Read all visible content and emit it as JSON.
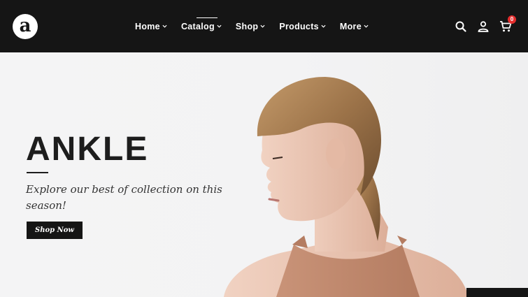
{
  "brand": {
    "logo_letter": "a",
    "logo_icon": "brand-logo"
  },
  "nav": {
    "items": [
      {
        "label": "Home"
      },
      {
        "label": "Catalog"
      },
      {
        "label": "Shop"
      },
      {
        "label": "Products"
      },
      {
        "label": "More"
      }
    ]
  },
  "header_icons": [
    "search-icon",
    "user-icon",
    "cart-icon"
  ],
  "cart": {
    "count": "0"
  },
  "hero": {
    "title": "ANKLE",
    "subtitle": "Explore our best of collection on this season!",
    "button_label": "Shop Now"
  },
  "colors": {
    "header_bg": "#151515",
    "badge": "#e52e2e",
    "hero_bg": "#f3f3f4",
    "text_dark": "#1d1d1d"
  }
}
